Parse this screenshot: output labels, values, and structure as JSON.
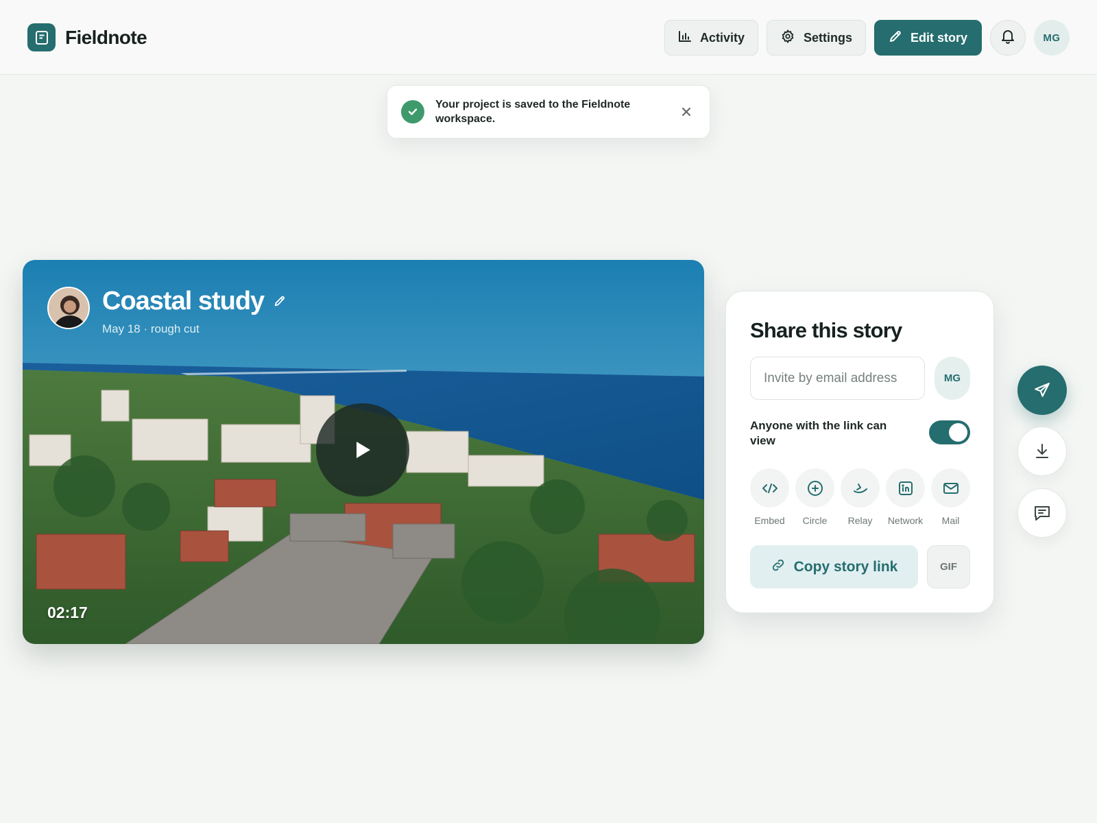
{
  "app": {
    "name": "Fieldnote",
    "accent": "#256d6e"
  },
  "header": {
    "activity_label": "Activity",
    "settings_label": "Settings",
    "edit_label": "Edit story",
    "user_initials": "MG"
  },
  "toast": {
    "message": "Your project is saved to the Fieldnote workspace.",
    "status": "success"
  },
  "video": {
    "title": "Coastal study",
    "subtitle": "May 18 · rough cut",
    "duration": "02:17"
  },
  "share": {
    "title": "Share this story",
    "invite_placeholder": "Invite by email address",
    "invite_avatar_initials": "MG",
    "link_permission_label": "Anyone with the link can view",
    "link_permission_enabled": true,
    "targets": [
      {
        "label": "Embed",
        "icon": "code-icon"
      },
      {
        "label": "Circle",
        "icon": "circle-plus-icon"
      },
      {
        "label": "Relay",
        "icon": "relay-icon"
      },
      {
        "label": "Network",
        "icon": "linkedin-icon"
      },
      {
        "label": "Mail",
        "icon": "mail-icon"
      }
    ],
    "copy_label": "Copy story link",
    "gif_label": "GIF"
  },
  "actions": [
    {
      "name": "send",
      "icon": "send-icon"
    },
    {
      "name": "download",
      "icon": "download-icon"
    },
    {
      "name": "comment",
      "icon": "comment-icon"
    }
  ]
}
